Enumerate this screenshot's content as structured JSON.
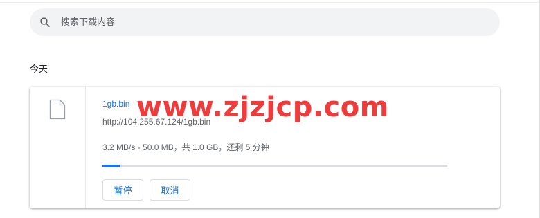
{
  "search": {
    "placeholder": "搜索下载内容",
    "icon": "search-icon"
  },
  "downloads": {
    "date_group": "今天",
    "items": [
      {
        "file_name": "1gb.bin",
        "url": "http://104.255.67.124/1gb.bin",
        "status": "3.2 MB/s - 50.0 MB，共 1.0 GB，还剩 5 分钟",
        "progress_fraction": 0.05,
        "icon": "file-icon",
        "actions": {
          "pause_label": "暂停",
          "cancel_label": "取消"
        }
      }
    ]
  },
  "watermark": "www.zjzjcp.com",
  "colors": {
    "accent": "#1a73e8",
    "search_bg": "#f1f3f4",
    "track": "#dadce0",
    "watermark": "#ee3b3b"
  }
}
